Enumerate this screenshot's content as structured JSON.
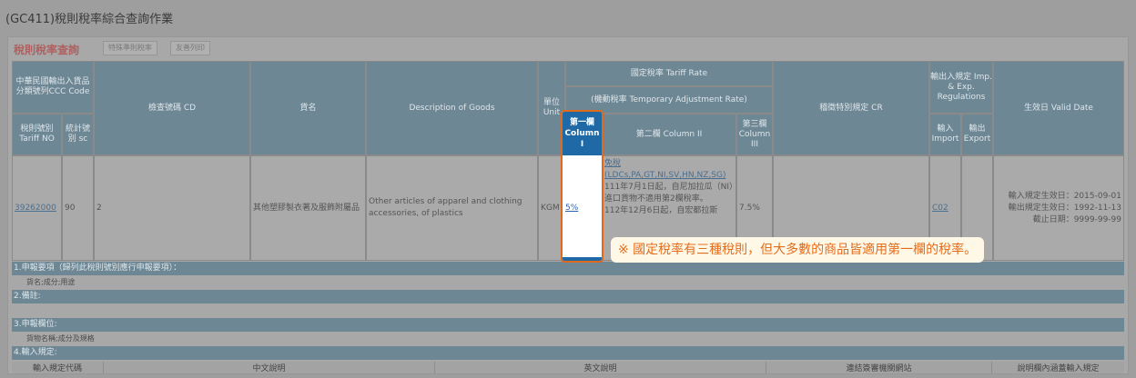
{
  "page": {
    "title": "(GC411)稅則稅率綜合查詢作業"
  },
  "toolbar": {
    "title": "稅則稅率查詢",
    "buttons": [
      "特殊準則稅率",
      "友善列印"
    ]
  },
  "table": {
    "headers": {
      "ccc_group": "中華民國輸出入貨品分類號列CCC Code",
      "tariff_no": "稅則號別 Tariff NO",
      "stat_no": "統計號別 sc",
      "cd": "檢查號碼 CD",
      "goods_zh": "貨名",
      "goods_en": "Description of Goods",
      "unit": "單位 Unit",
      "tariff_rate": "國定稅率 Tariff Rate",
      "temp_rate": "(機動稅率 Temporary Adjustment Rate)",
      "col1": "第一欄 Column I",
      "col2": "第二欄 Column II",
      "col3": "第三欄 Column III",
      "cr": "稽徵特別規定 CR",
      "imp_exp": "輸出入規定 Imp. & Exp. Regulations",
      "import": "輸入 Import",
      "export": "輸出 Export",
      "valid_date": "生效日 Valid Date"
    },
    "row": {
      "tariff_no": "39262000",
      "stat_no": "90",
      "cd": "2",
      "goods_zh": "其他塑膠製衣著及服飾附屬品",
      "goods_en": "Other articles of apparel and clothing accessories, of plastics",
      "unit": "KGM",
      "col1": "5%",
      "col2_link_1": "免稅",
      "col2_link_2": "(LDCs,PA,GT,NI,SV,HN,NZ,SG)",
      "col2_note_1": "111年7月1日起，自尼加拉瓜（NI）進口貨物不適用第2欄稅率。",
      "col2_note_2": "112年12月6日起，自宏都拉斯",
      "col3": "7.5%",
      "import": "C02",
      "valid_1": "輸入規定生效日：2015-09-01",
      "valid_2": "輸出規定生效日：1992-11-13",
      "valid_3": "截止日期：9999-99-99"
    }
  },
  "sections": [
    {
      "title": "1.申報要項（歸列此稅則號別應行申報要項）：",
      "content": "貨名;成分;用途"
    },
    {
      "title": "2.備註:",
      "content": ""
    },
    {
      "title": "3.申報欄位:",
      "content": "貨物名稱;成分及規格"
    },
    {
      "title": "4.輸入規定:",
      "content": ""
    }
  ],
  "bottom_headers": [
    "輸入規定代碼",
    "中文說明",
    "英文說明",
    "連結簽審機關網站",
    "說明欄內涵蓋輸入規定"
  ],
  "callout": "※ 國定稅率有三種稅則，但大多數的商品皆適用第一欄的稅率。",
  "colors": {
    "header_bg": "#6d8795",
    "highlight_border": "#e06a1c",
    "highlight_head": "#1f6aa6",
    "callout_text": "#e46d1c"
  }
}
